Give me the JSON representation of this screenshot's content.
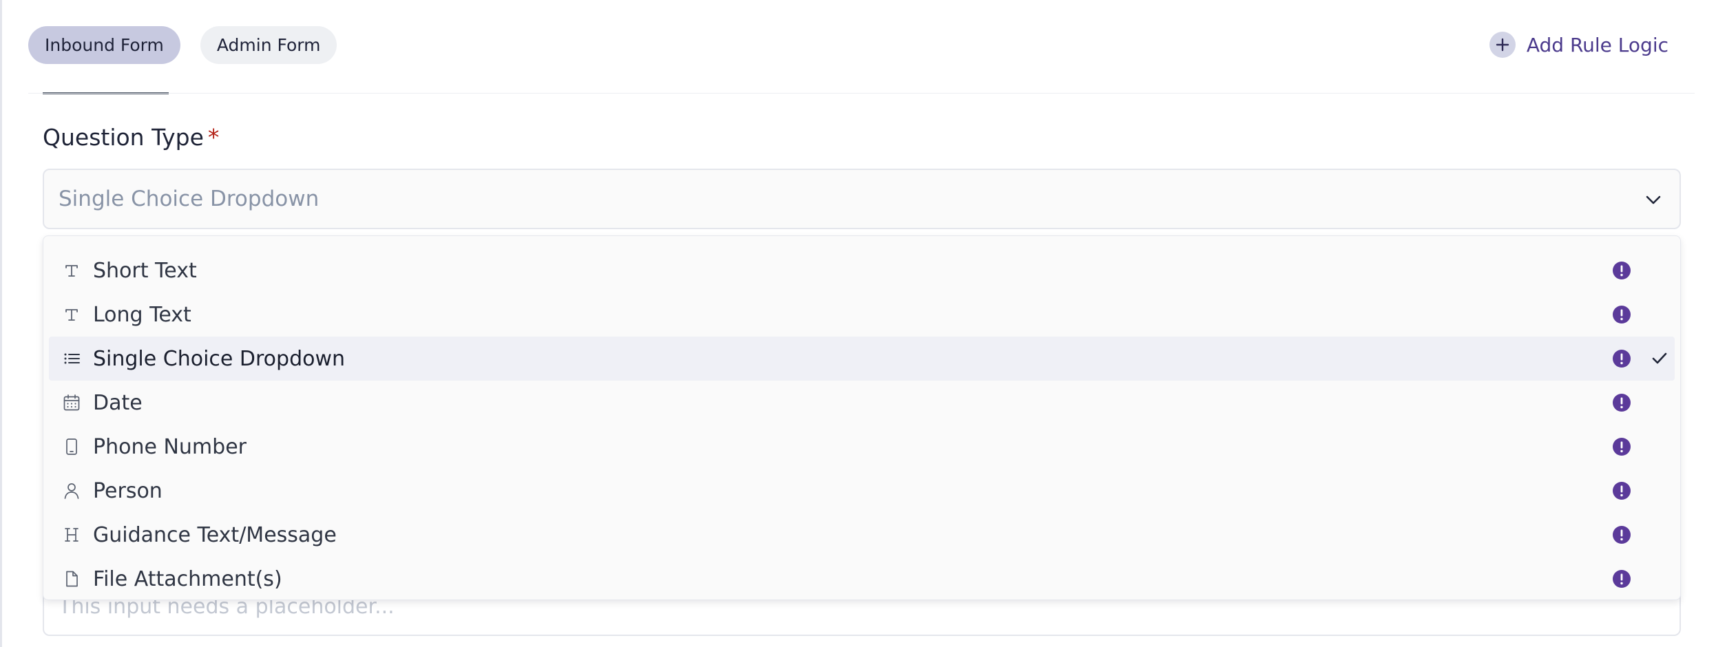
{
  "tabs": [
    {
      "label": "Inbound Form",
      "active": true
    },
    {
      "label": "Admin Form",
      "active": false
    }
  ],
  "add_rule": {
    "label": "Add Rule Logic",
    "icon": "plus-circle-icon"
  },
  "question_type": {
    "label": "Question Type",
    "required_marker": "*",
    "selected_value": "Single Choice Dropdown"
  },
  "menu": {
    "items": [
      {
        "label": "Short Text",
        "icon": "text-type-icon",
        "selected": false
      },
      {
        "label": "Long Text",
        "icon": "text-type-icon",
        "selected": false
      },
      {
        "label": "Single Choice Dropdown",
        "icon": "list-icon",
        "selected": true
      },
      {
        "label": "Date",
        "icon": "calendar-icon",
        "selected": false
      },
      {
        "label": "Phone Number",
        "icon": "phone-icon",
        "selected": false
      },
      {
        "label": "Person",
        "icon": "person-icon",
        "selected": false
      },
      {
        "label": "Guidance Text/Message",
        "icon": "heading-icon",
        "selected": false
      },
      {
        "label": "File Attachment(s)",
        "icon": "file-icon",
        "selected": false
      }
    ]
  },
  "placeholder_field": {
    "placeholder": "This input needs a placeholder..."
  },
  "colors": {
    "accent": "#4b3a8c",
    "info_badge": "#5b3a9a",
    "active_tab": "#c7c9e0"
  }
}
